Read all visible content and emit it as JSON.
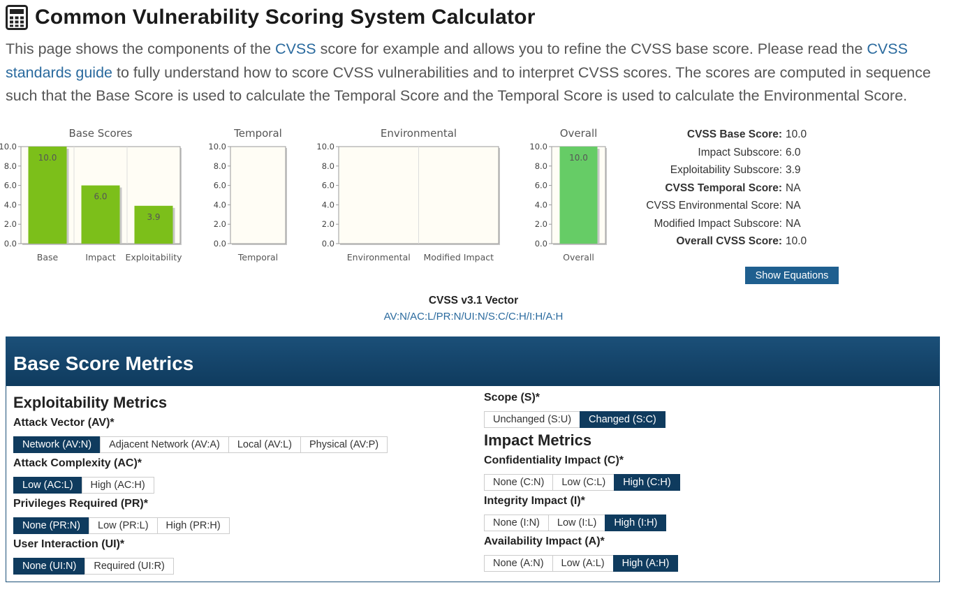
{
  "page": {
    "title": "Common Vulnerability Scoring System Calculator",
    "intro": {
      "t1": "This page shows the components of the ",
      "link1": "CVSS",
      "t2": " score for example and allows you to refine the CVSS base score. Please read the ",
      "link2": "CVSS standards guide",
      "t3": " to fully understand how to score CVSS vulnerabilities and to interpret CVSS scores. The scores are computed in sequence such that the Base Score is used to calculate the Temporal Score and the Temporal Score is used to calculate the Environmental Score."
    }
  },
  "chart_data": [
    {
      "type": "bar",
      "title": "Base Scores",
      "categories": [
        "Base",
        "Impact",
        "Exploitability"
      ],
      "values": [
        10.0,
        6.0,
        3.9
      ],
      "value_labels": [
        "10.0",
        "6.0",
        "3.9"
      ],
      "ylim": [
        0,
        10
      ],
      "yticks": [
        "0.0",
        "2.0",
        "4.0",
        "6.0",
        "8.0",
        "10.0"
      ],
      "color": "#7cbf1a"
    },
    {
      "type": "bar",
      "title": "Temporal",
      "categories": [
        "Temporal"
      ],
      "values": [
        null
      ],
      "ylim": [
        0,
        10
      ],
      "yticks": [
        "0.0",
        "2.0",
        "4.0",
        "6.0",
        "8.0",
        "10.0"
      ]
    },
    {
      "type": "bar",
      "title": "Environmental",
      "categories": [
        "Environmental",
        "Modified Impact"
      ],
      "values": [
        null,
        null
      ],
      "ylim": [
        0,
        10
      ],
      "yticks": [
        "0.0",
        "2.0",
        "4.0",
        "6.0",
        "8.0",
        "10.0"
      ]
    },
    {
      "type": "bar",
      "title": "Overall",
      "categories": [
        "Overall"
      ],
      "values": [
        10.0
      ],
      "value_labels": [
        "10.0"
      ],
      "ylim": [
        0,
        10
      ],
      "yticks": [
        "0.0",
        "2.0",
        "4.0",
        "6.0",
        "8.0",
        "10.0"
      ],
      "color": "#66cc66"
    }
  ],
  "scores": [
    {
      "label": "CVSS Base Score:",
      "value": "10.0",
      "bold": true
    },
    {
      "label": "Impact Subscore:",
      "value": "6.0",
      "bold": false
    },
    {
      "label": "Exploitability Subscore:",
      "value": "3.9",
      "bold": false
    },
    {
      "label": "CVSS Temporal Score:",
      "value": "NA",
      "bold": true
    },
    {
      "label": "CVSS Environmental Score:",
      "value": "NA",
      "bold": false
    },
    {
      "label": "Modified Impact Subscore:",
      "value": "NA",
      "bold": false
    },
    {
      "label": "Overall CVSS Score:",
      "value": "10.0",
      "bold": true
    }
  ],
  "show_equations_label": "Show Equations",
  "vector": {
    "title": "CVSS v3.1 Vector",
    "value": "AV:N/AC:L/PR:N/UI:N/S:C/C:H/I:H/A:H"
  },
  "metrics": {
    "header": "Base Score Metrics",
    "exploitability": {
      "title": "Exploitability Metrics",
      "av": {
        "label": "Attack Vector (AV)*",
        "options": [
          "Network (AV:N)",
          "Adjacent Network (AV:A)",
          "Local (AV:L)",
          "Physical (AV:P)"
        ],
        "selected": 0
      },
      "ac": {
        "label": "Attack Complexity (AC)*",
        "options": [
          "Low (AC:L)",
          "High (AC:H)"
        ],
        "selected": 0
      },
      "pr": {
        "label": "Privileges Required (PR)*",
        "options": [
          "None (PR:N)",
          "Low (PR:L)",
          "High (PR:H)"
        ],
        "selected": 0
      },
      "ui": {
        "label": "User Interaction (UI)*",
        "options": [
          "None (UI:N)",
          "Required (UI:R)"
        ],
        "selected": 0
      }
    },
    "scope": {
      "label": "Scope (S)*",
      "options": [
        "Unchanged (S:U)",
        "Changed (S:C)"
      ],
      "selected": 1
    },
    "impact": {
      "title": "Impact Metrics",
      "c": {
        "label": "Confidentiality Impact (C)*",
        "options": [
          "None (C:N)",
          "Low (C:L)",
          "High (C:H)"
        ],
        "selected": 2
      },
      "i": {
        "label": "Integrity Impact (I)*",
        "options": [
          "None (I:N)",
          "Low (I:L)",
          "High (I:H)"
        ],
        "selected": 2
      },
      "a": {
        "label": "Availability Impact (A)*",
        "options": [
          "None (A:N)",
          "Low (A:L)",
          "High (A:H)"
        ],
        "selected": 2
      }
    }
  },
  "colors": {
    "accent": "#0f3b5e",
    "link": "#2a6a9e",
    "base_bar": "#7cbf1a",
    "overall_bar": "#66cc66",
    "plot_bg": "#fffdf5"
  }
}
